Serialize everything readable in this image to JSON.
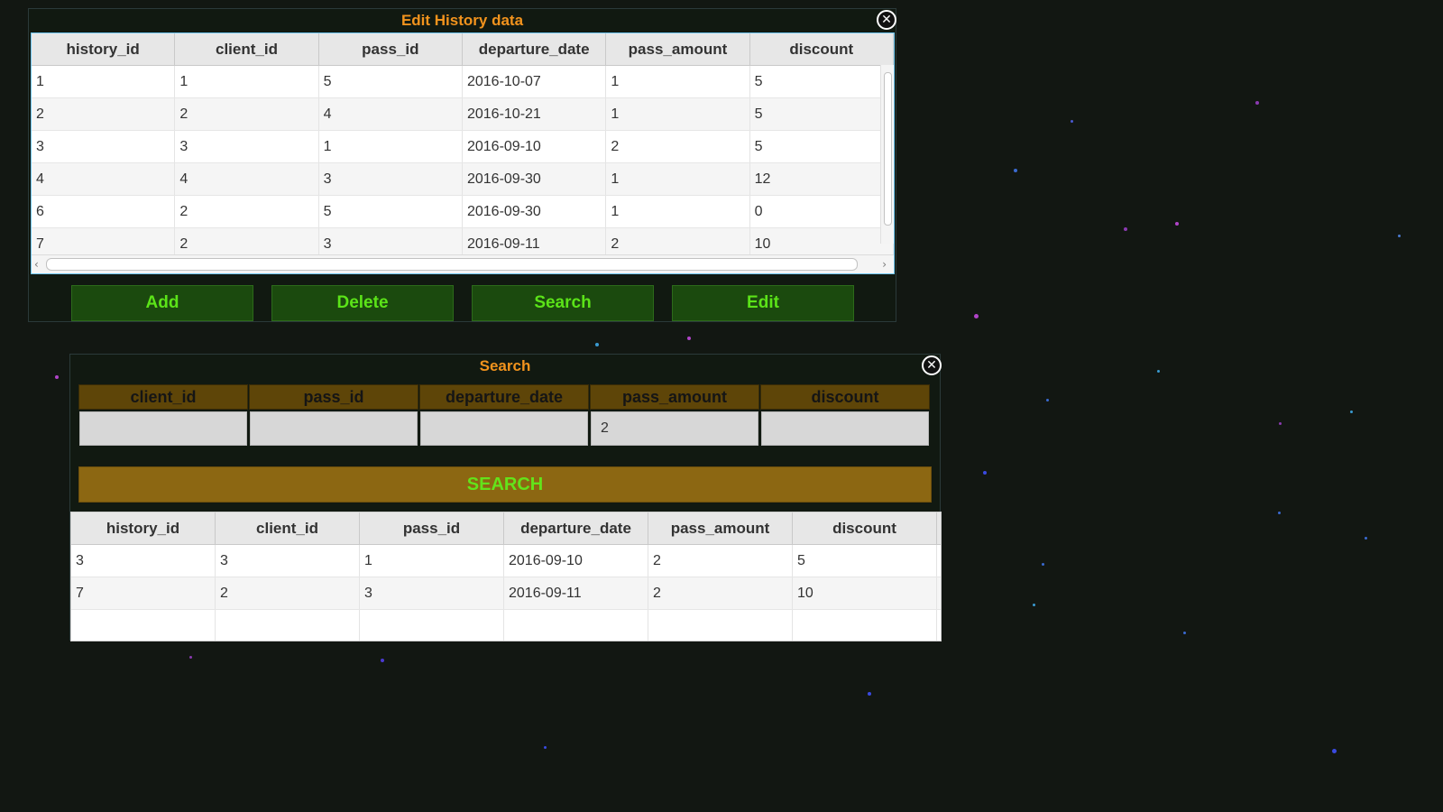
{
  "background": {
    "color": "#121712"
  },
  "edit_window": {
    "title": "Edit History data",
    "columns": [
      "history_id",
      "client_id",
      "pass_id",
      "departure_date",
      "pass_amount",
      "discount"
    ],
    "rows": [
      [
        "1",
        "1",
        "5",
        "2016-10-07",
        "1",
        "5"
      ],
      [
        "2",
        "2",
        "4",
        "2016-10-21",
        "1",
        "5"
      ],
      [
        "3",
        "3",
        "1",
        "2016-09-10",
        "2",
        "5"
      ],
      [
        "4",
        "4",
        "3",
        "2016-09-30",
        "1",
        "12"
      ],
      [
        "6",
        "2",
        "5",
        "2016-09-30",
        "1",
        "0"
      ],
      [
        "7",
        "2",
        "3",
        "2016-09-11",
        "2",
        "10"
      ]
    ],
    "buttons": {
      "add": "Add",
      "delete": "Delete",
      "search": "Search",
      "edit": "Edit"
    }
  },
  "search_window": {
    "title": "Search",
    "fields": [
      {
        "label": "client_id",
        "value": ""
      },
      {
        "label": "pass_id",
        "value": ""
      },
      {
        "label": "departure_date",
        "value": ""
      },
      {
        "label": "pass_amount",
        "value": "2"
      },
      {
        "label": "discount",
        "value": ""
      }
    ],
    "search_button": "SEARCH",
    "columns": [
      "history_id",
      "client_id",
      "pass_id",
      "departure_date",
      "pass_amount",
      "discount"
    ],
    "rows": [
      [
        "3",
        "3",
        "1",
        "2016-09-10",
        "2",
        "5"
      ],
      [
        "7",
        "2",
        "3",
        "2016-09-11",
        "2",
        "10"
      ]
    ]
  },
  "colors": {
    "title": "#f2931d",
    "button_green_bg": "#1b4a0e",
    "button_green_text": "#5be318",
    "search_header_bg": "#5e4508",
    "search_button_bg": "#8c6712"
  }
}
